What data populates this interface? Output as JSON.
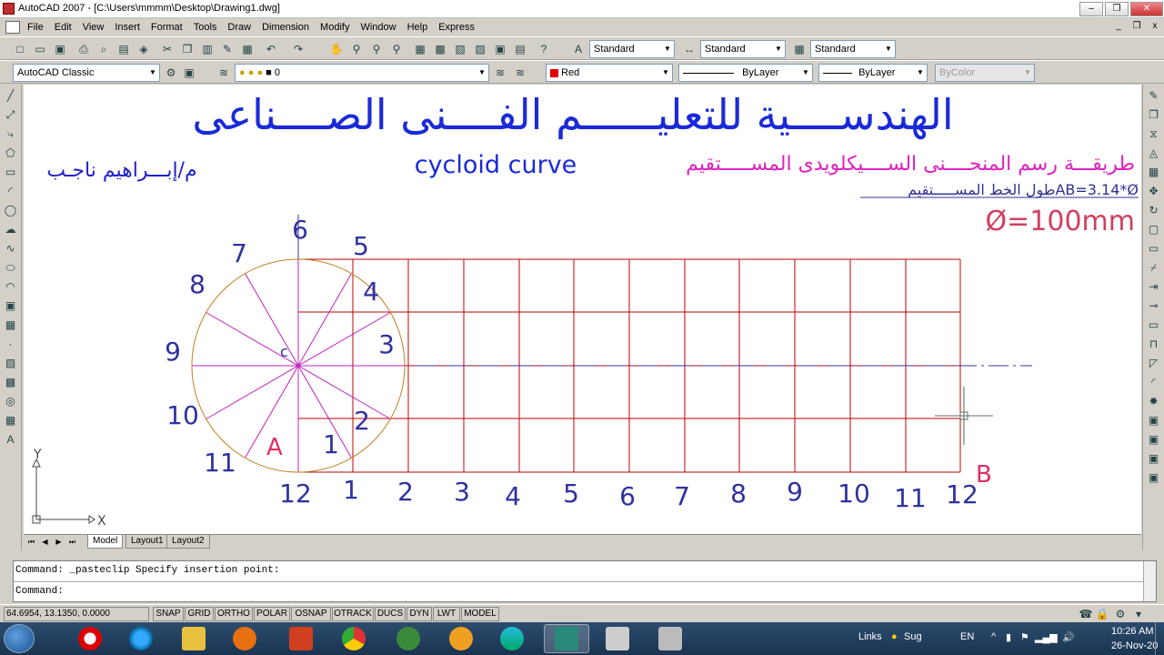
{
  "window": {
    "title": "AutoCAD 2007 - [C:\\Users\\mmmm\\Desktop\\Drawing1.dwg]",
    "minimize": "‒",
    "restore": "❐",
    "close": "✕",
    "doc_minimize": "_",
    "doc_restore": "❐",
    "doc_close": "x"
  },
  "menu": [
    "File",
    "Edit",
    "View",
    "Insert",
    "Format",
    "Tools",
    "Draw",
    "Dimension",
    "Modify",
    "Window",
    "Help",
    "Express"
  ],
  "toolbar1": {
    "text_style": "Standard",
    "dim_style": "Standard",
    "table_style": "Standard"
  },
  "toolbar2": {
    "workspace": "AutoCAD Classic",
    "layer": "0",
    "color": "Red",
    "color_swatch": "#e00000",
    "linetype": "ByLayer",
    "lineweight": "ByLayer",
    "plotstyle": "ByColor"
  },
  "drawing": {
    "title_arabic": "الهندســــية للتعليــــــم الفــــنى الصــــناعى",
    "author": "م/إبـــراهيم ناجـب",
    "subtitle_en": "cycloid curve",
    "subtitle_ar": "طريقـــة رسم المنحــــنى الســــيكلويدى المســـــتقيم",
    "formula": "طول الخط المســـــتقيمAB=3.14*Ø",
    "diameter": "Ø=100mm",
    "circle_labels": [
      "1",
      "2",
      "3",
      "4",
      "5",
      "6",
      "7",
      "8",
      "9",
      "10",
      "11",
      "12"
    ],
    "baseline_labels": [
      "12",
      "1",
      "2",
      "3",
      "4",
      "5",
      "6",
      "7",
      "8",
      "9",
      "10",
      "11",
      "12"
    ],
    "point_a": "A",
    "point_b": "B",
    "center_label": "c",
    "ucs_x": "X",
    "ucs_y": "Y"
  },
  "layout_tabs": [
    "Model",
    "Layout1",
    "Layout2"
  ],
  "command": {
    "history": "Command: _pasteclip Specify insertion point:",
    "prompt": "Command:"
  },
  "status": {
    "coords": "64.6954, 13.1350, 0.0000",
    "buttons": [
      "SNAP",
      "GRID",
      "ORTHO",
      "POLAR",
      "OSNAP",
      "OTRACK",
      "DUCS",
      "DYN",
      "LWT",
      "MODEL"
    ]
  },
  "taskbar": {
    "links": "Links",
    "search": "Sug",
    "lang": "EN",
    "time": "10:26 AM",
    "date": "26-Nov-20"
  }
}
